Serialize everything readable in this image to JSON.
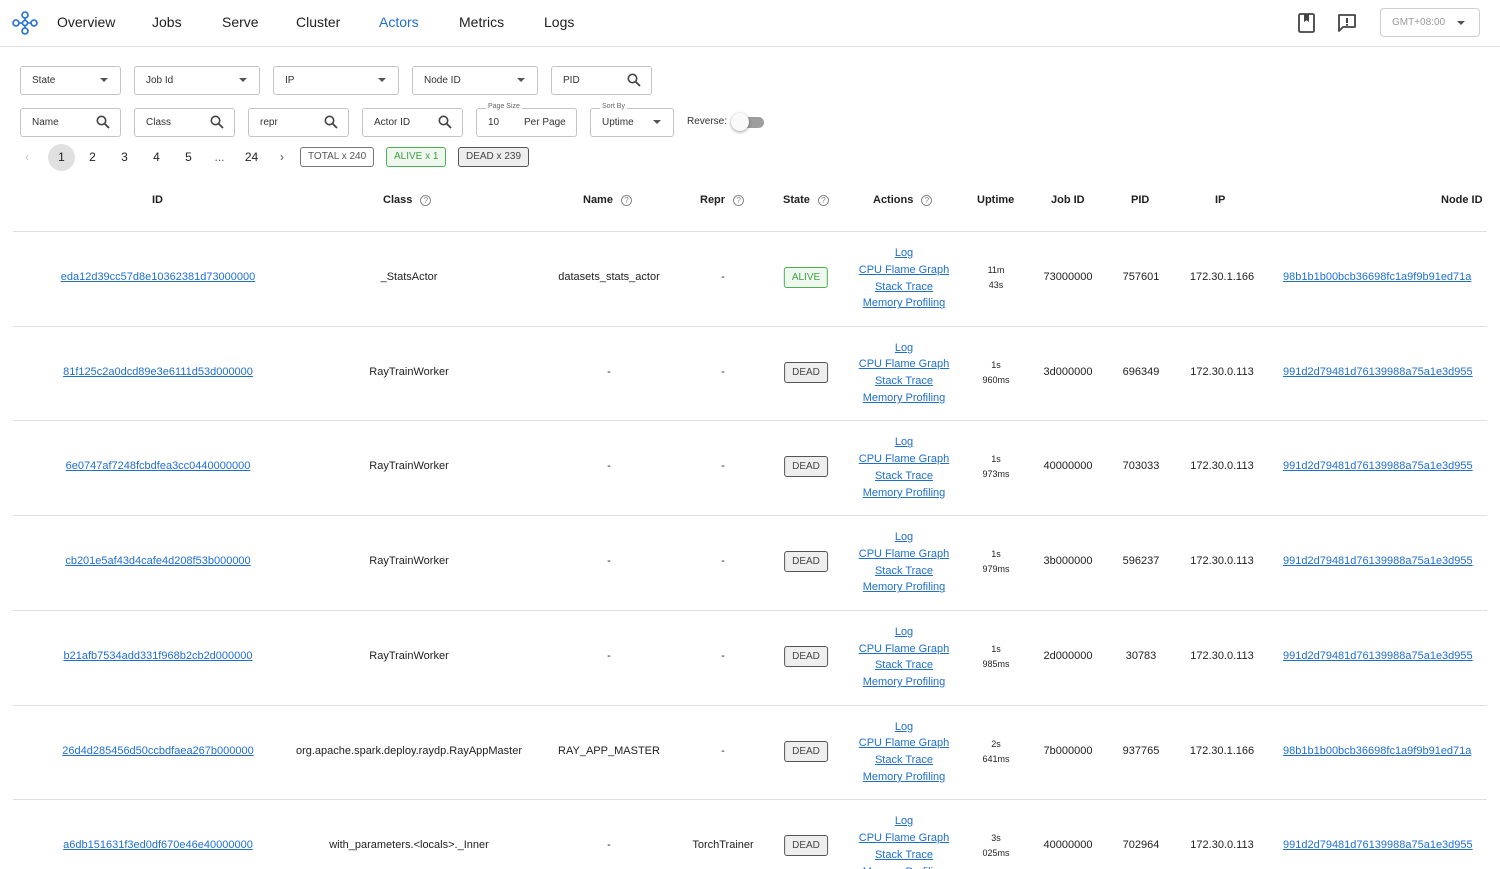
{
  "nav": {
    "items": [
      "Overview",
      "Jobs",
      "Serve",
      "Cluster",
      "Actors",
      "Metrics",
      "Logs"
    ],
    "active": "Actors",
    "timezone": "GMT+08:00"
  },
  "filters": {
    "state": "State",
    "job_id": "Job Id",
    "ip": "IP",
    "node_id": "Node ID",
    "pid": "PID",
    "name": "Name",
    "class": "Class",
    "repr": "repr",
    "actor_id": "Actor ID",
    "page_size_label": "Page Size",
    "page_size_value": "10",
    "page_size_suffix": "Per Page",
    "sort_by_label": "Sort By",
    "sort_by_value": "Uptime",
    "reverse_label": "Reverse:",
    "reverse_on": false
  },
  "pagination": {
    "pages": [
      "1",
      "2",
      "3",
      "4",
      "5",
      "...",
      "24"
    ],
    "current": "1",
    "total": "TOTAL x 240",
    "alive": "ALIVE x 1",
    "dead": "DEAD x 239"
  },
  "table": {
    "headers": {
      "id": "ID",
      "class": "Class",
      "name": "Name",
      "repr": "Repr",
      "state": "State",
      "actions": "Actions",
      "uptime": "Uptime",
      "job_id": "Job ID",
      "pid": "PID",
      "ip": "IP",
      "node_id": "Node ID"
    },
    "action_labels": [
      "Log",
      "CPU Flame Graph",
      "Stack Trace",
      "Memory Profiling"
    ],
    "rows": [
      {
        "id": "eda12d39cc57d8e10362381d73000000",
        "class": "_StatsActor",
        "name": "datasets_stats_actor",
        "repr": "-",
        "state": "ALIVE",
        "uptime1": "11m",
        "uptime2": "43s",
        "job_id": "73000000",
        "pid": "757601",
        "ip": "172.30.1.166",
        "node_id": "98b1b1b00bcb36698fc1a9f9b91ed71a"
      },
      {
        "id": "81f125c2a0dcd89e3e6111d53d000000",
        "class": "RayTrainWorker",
        "name": "-",
        "repr": "-",
        "state": "DEAD",
        "uptime1": "1s",
        "uptime2": "960ms",
        "job_id": "3d000000",
        "pid": "696349",
        "ip": "172.30.0.113",
        "node_id": "991d2d79481d76139988a75a1e3d955"
      },
      {
        "id": "6e0747af7248fcbdfea3cc0440000000",
        "class": "RayTrainWorker",
        "name": "-",
        "repr": "-",
        "state": "DEAD",
        "uptime1": "1s",
        "uptime2": "973ms",
        "job_id": "40000000",
        "pid": "703033",
        "ip": "172.30.0.113",
        "node_id": "991d2d79481d76139988a75a1e3d955"
      },
      {
        "id": "cb201e5af43d4cafe4d208f53b000000",
        "class": "RayTrainWorker",
        "name": "-",
        "repr": "-",
        "state": "DEAD",
        "uptime1": "1s",
        "uptime2": "979ms",
        "job_id": "3b000000",
        "pid": "596237",
        "ip": "172.30.0.113",
        "node_id": "991d2d79481d76139988a75a1e3d955"
      },
      {
        "id": "b21afb7534add331f968b2cb2d000000",
        "class": "RayTrainWorker",
        "name": "-",
        "repr": "-",
        "state": "DEAD",
        "uptime1": "1s",
        "uptime2": "985ms",
        "job_id": "2d000000",
        "pid": "30783",
        "ip": "172.30.0.113",
        "node_id": "991d2d79481d76139988a75a1e3d955"
      },
      {
        "id": "26d4d285456d50ccbdfaea267b000000",
        "class": "org.apache.spark.deploy.raydp.RayAppMaster",
        "name": "RAY_APP_MASTER",
        "repr": "-",
        "state": "DEAD",
        "uptime1": "2s",
        "uptime2": "641ms",
        "job_id": "7b000000",
        "pid": "937765",
        "ip": "172.30.1.166",
        "node_id": "98b1b1b00bcb36698fc1a9f9b91ed71a"
      },
      {
        "id": "a6db151631f3ed0df670e46e40000000",
        "class": "with_parameters.<locals>._Inner",
        "name": "-",
        "repr": "TorchTrainer",
        "state": "DEAD",
        "uptime1": "3s",
        "uptime2": "025ms",
        "job_id": "40000000",
        "pid": "702964",
        "ip": "172.30.0.113",
        "node_id": "991d2d79481d76139988a75a1e3d955"
      }
    ]
  },
  "colors": {
    "accent": "#1f6fd1",
    "alive": "#43a047",
    "divider": "#e0e0e0"
  }
}
